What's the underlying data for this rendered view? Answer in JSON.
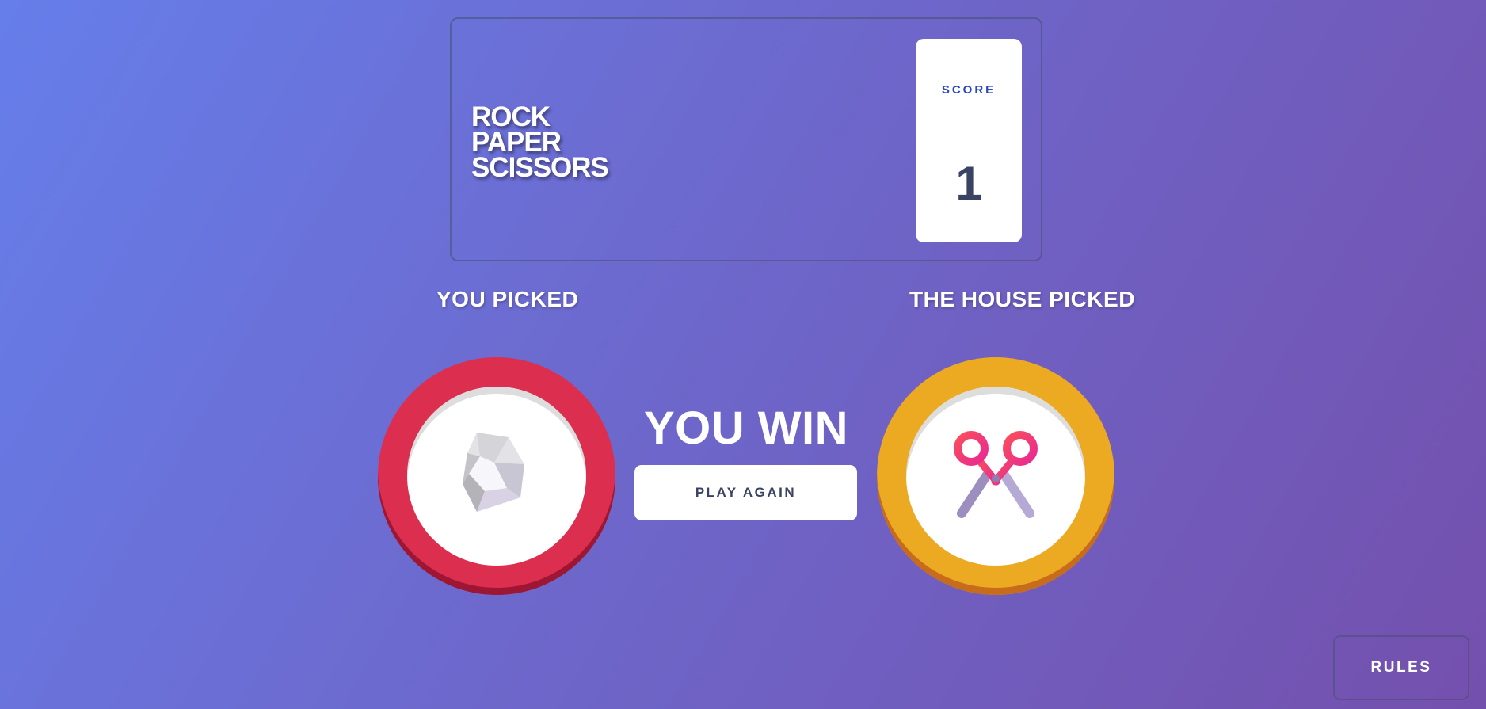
{
  "header": {
    "logo_lines": [
      "ROCK",
      "PAPER",
      "SCISSORS"
    ],
    "score_label": "SCORE",
    "score_value": "1"
  },
  "picks": {
    "you_label": "YOU PICKED",
    "house_label": "THE HOUSE PICKED",
    "you_choice": "rock",
    "house_choice": "scissors"
  },
  "result": {
    "text": "YOU WIN",
    "play_again_label": "PLAY AGAIN"
  },
  "footer": {
    "rules_label": "RULES"
  },
  "colors": {
    "rock_chip": "#dc2e4e",
    "scissors_chip": "#eca922",
    "score_label": "#2a46c0",
    "dark_text": "#3b4363"
  },
  "icons": {
    "you_icon": "rock-icon",
    "house_icon": "scissors-icon"
  }
}
